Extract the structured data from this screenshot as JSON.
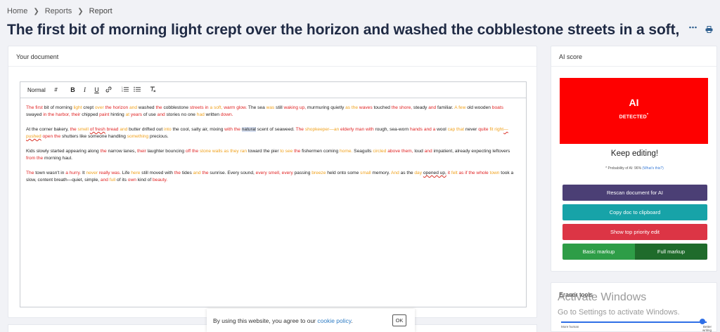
{
  "breadcrumb": {
    "home": "Home",
    "reports": "Reports",
    "current": "Report"
  },
  "page_title": "The first bit of morning light crept over the horizon and washed the cobblestone streets in a soft,",
  "document_card": {
    "title": "Your document"
  },
  "toolbar": {
    "format": "Normal",
    "bold": "B",
    "italic": "I",
    "underline": "U"
  },
  "editor": {
    "paragraphs": [
      [
        [
          "r",
          "The first"
        ],
        [
          "n",
          " bit of morning "
        ],
        [
          "o",
          "light"
        ],
        [
          "n",
          " crept "
        ],
        [
          "o",
          "over"
        ],
        [
          "r",
          " the horizon"
        ],
        [
          "o",
          " and"
        ],
        [
          "n",
          " washed "
        ],
        [
          "r",
          "the"
        ],
        [
          "n",
          " cobblestone "
        ],
        [
          "r",
          "streets in"
        ],
        [
          "o",
          " a soft,"
        ],
        [
          "r",
          " warm glow."
        ],
        [
          "n",
          " The sea "
        ],
        [
          "o",
          "was"
        ],
        [
          "n",
          " still "
        ],
        [
          "r",
          "waking up,"
        ],
        [
          "n",
          " murmuring quietly "
        ],
        [
          "o",
          "as the"
        ],
        [
          "r",
          " waves"
        ],
        [
          "n",
          " touched "
        ],
        [
          "r",
          "the shore,"
        ],
        [
          "n",
          " steady "
        ],
        [
          "r",
          "and"
        ],
        [
          "n",
          " familiar. "
        ],
        [
          "o",
          "A few"
        ],
        [
          "n",
          " old wooden "
        ],
        [
          "r",
          "boats"
        ],
        [
          "n",
          " swayed "
        ],
        [
          "r",
          "in the harbor,"
        ],
        [
          "n",
          " "
        ],
        [
          "r",
          "their"
        ],
        [
          "n",
          " chipped "
        ],
        [
          "r",
          "paint"
        ],
        [
          "n",
          " hinting "
        ],
        [
          "o",
          "at"
        ],
        [
          "r",
          " years"
        ],
        [
          "n",
          " of use "
        ],
        [
          "r",
          "and"
        ],
        [
          "n",
          " stories no one "
        ],
        [
          "o",
          "had"
        ],
        [
          "n",
          " written "
        ],
        [
          "r",
          "down."
        ]
      ],
      [
        [
          "n",
          "At the corner bakery, "
        ],
        [
          "r",
          "the"
        ],
        [
          "o",
          " smell "
        ],
        [
          "sq",
          "of fresh"
        ],
        [
          "r",
          " bread"
        ],
        [
          "o",
          " and"
        ],
        [
          "n",
          " butter drifted out "
        ],
        [
          "o",
          "into"
        ],
        [
          "n",
          " the cool, salty air, mixing "
        ],
        [
          "r",
          "with the"
        ],
        [
          "n",
          " "
        ],
        [
          "hl",
          "natural"
        ],
        [
          "n",
          "  scent of seaweed. "
        ],
        [
          "r",
          "The"
        ],
        [
          "o",
          " shopkeeper—an"
        ],
        [
          "r",
          " elderly man with"
        ],
        [
          "n",
          " rough, sea-worn "
        ],
        [
          "r",
          "hands and a"
        ],
        [
          "n",
          " wool "
        ],
        [
          "o",
          "cap that"
        ],
        [
          "n",
          " never "
        ],
        [
          "r",
          "quite"
        ],
        [
          "o",
          " fit right"
        ],
        [
          "sqo",
          "—pushed"
        ],
        [
          "r",
          " open the"
        ],
        [
          "n",
          " shutters like someone handling "
        ],
        [
          "o",
          "something"
        ],
        [
          "n",
          " precious."
        ]
      ],
      [
        [
          "n",
          "Kids slowly started appearing along "
        ],
        [
          "r",
          "the"
        ],
        [
          "n",
          " narrow lanes, "
        ],
        [
          "r",
          "their"
        ],
        [
          "n",
          " laughter bouncing "
        ],
        [
          "r",
          "off the"
        ],
        [
          "o",
          " stone walls"
        ],
        [
          "n",
          " "
        ],
        [
          "o",
          "as they"
        ],
        [
          "o",
          " ran"
        ],
        [
          "n",
          " toward the pier "
        ],
        [
          "o",
          "to see"
        ],
        [
          "r",
          " the"
        ],
        [
          "n",
          " fishermen coming "
        ],
        [
          "o",
          "home."
        ],
        [
          "n",
          " Seagulls "
        ],
        [
          "o",
          "circled"
        ],
        [
          "r",
          " above them,"
        ],
        [
          "n",
          " loud "
        ],
        [
          "r",
          "and"
        ],
        [
          "n",
          " impatient, already expecting leftovers "
        ],
        [
          "r",
          "from the"
        ],
        [
          "n",
          " morning haul."
        ]
      ],
      [
        [
          "r",
          "The"
        ],
        [
          "n",
          " town wasn't in "
        ],
        [
          "r",
          "a hurry."
        ],
        [
          "n",
          " It "
        ],
        [
          "o",
          "never"
        ],
        [
          "r",
          " really was."
        ],
        [
          "n",
          " Life "
        ],
        [
          "o",
          "here"
        ],
        [
          "n",
          " still moved with "
        ],
        [
          "r",
          "the"
        ],
        [
          "n",
          " tides "
        ],
        [
          "o",
          "and"
        ],
        [
          "r",
          " the"
        ],
        [
          "n",
          " sunrise. Every sound, "
        ],
        [
          "r",
          "every smell, every"
        ],
        [
          "n",
          " passing "
        ],
        [
          "o",
          "breeze"
        ],
        [
          "n",
          " held onto some "
        ],
        [
          "o",
          "small"
        ],
        [
          "n",
          " memory. "
        ],
        [
          "o",
          "And"
        ],
        [
          "n",
          " as the "
        ],
        [
          "o",
          "day"
        ],
        [
          "n",
          " "
        ],
        [
          "sqd",
          "opened up,"
        ],
        [
          "n",
          " "
        ],
        [
          "r",
          "it"
        ],
        [
          "o",
          " felt"
        ],
        [
          "r",
          " as if the whole"
        ],
        [
          "o",
          " town"
        ],
        [
          "n",
          " took a slow, content breath—quiet, simple, "
        ],
        [
          "r",
          "and"
        ],
        [
          "o",
          " full"
        ],
        [
          "n",
          " of its "
        ],
        [
          "r",
          "own"
        ],
        [
          "n",
          " kind of "
        ],
        [
          "r",
          "beauty."
        ]
      ]
    ]
  },
  "ai_score": {
    "title": "AI score",
    "result": "AI",
    "status": "DETECTED",
    "status_mark": "*",
    "keep_editing": "Keep editing!",
    "probability_text": "* Probability of AI: 96%",
    "whats_this": "(What's this?)",
    "buttons": {
      "rescan": "Rescan document for AI",
      "copy": "Copy doc to clipboard",
      "top_priority": "Show top priority edit",
      "basic_markup": "Basic markup",
      "full_markup": "Full markup"
    },
    "colors": {
      "detected": "#fe0000",
      "rescan": "#4b3f75",
      "copy": "#17a3a8",
      "top": "#dc3545",
      "basic": "#2e9d47",
      "full": "#1f6b2b"
    }
  },
  "eraser_tools": {
    "title": "Eraser tools",
    "left_label": "More human",
    "right_label": "Better writing",
    "slider_value": 0.97
  },
  "activate_windows": {
    "line1": "Activate Windows",
    "line2": "Go to Settings to activate Windows."
  },
  "cookie": {
    "message": "By using this website, you agree to our",
    "link": "cookie policy",
    "period": ".",
    "ok": "OK"
  }
}
